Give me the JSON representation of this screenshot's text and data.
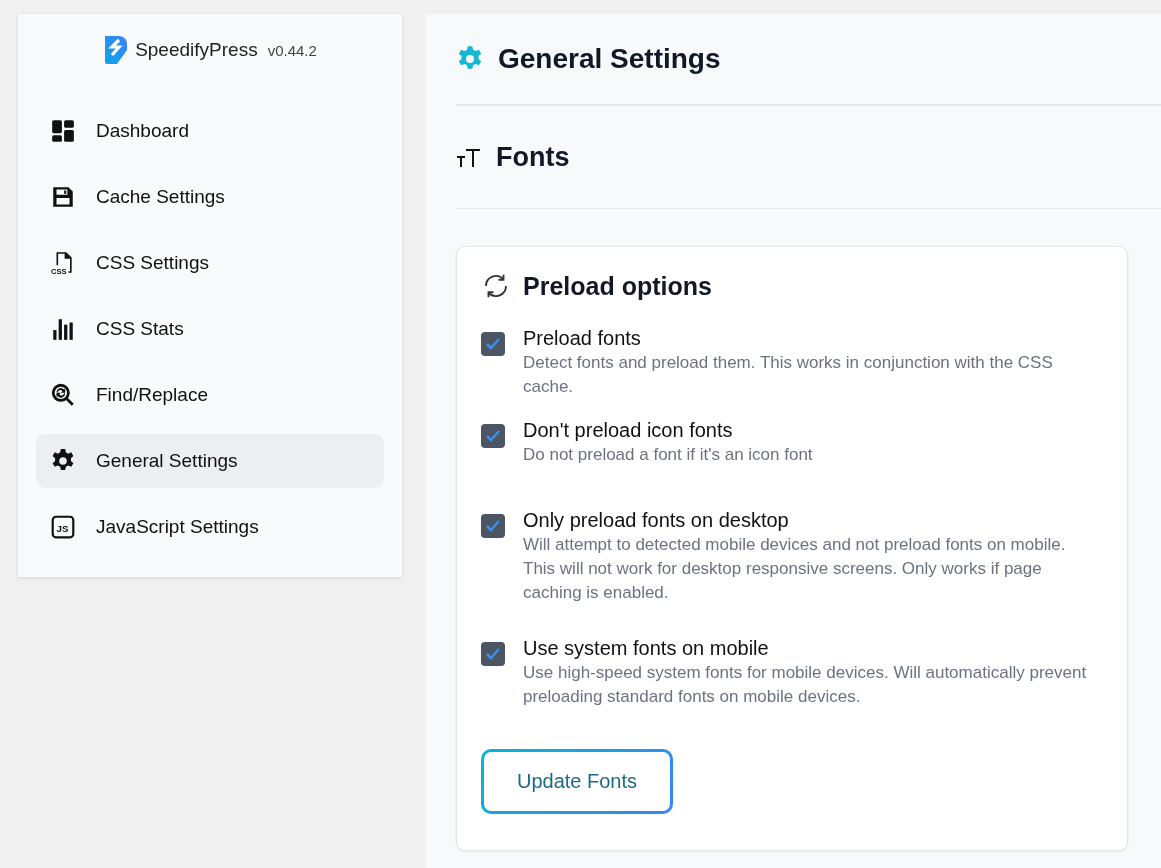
{
  "sidebar": {
    "brand": "SpeedifyPress",
    "version": "v0.44.2",
    "items": [
      {
        "label": "Dashboard",
        "selected": false
      },
      {
        "label": "Cache Settings",
        "selected": false
      },
      {
        "label": "CSS Settings",
        "selected": false,
        "icon_text": "CSS"
      },
      {
        "label": "CSS Stats",
        "selected": false
      },
      {
        "label": "Find/Replace",
        "selected": false
      },
      {
        "label": "General Settings",
        "selected": true
      },
      {
        "label": "JavaScript Settings",
        "selected": false,
        "icon_text": "JS"
      }
    ]
  },
  "page": {
    "title": "General Settings",
    "section": "Fonts",
    "card": {
      "title": "Preload options",
      "options": [
        {
          "label": "Preload fonts",
          "description": "Detect fonts and preload them. This works in conjunction with the CSS cache.",
          "checked": true
        },
        {
          "label": "Don't preload icon fonts",
          "description": "Do not preload a font if it's an icon font",
          "checked": true
        },
        {
          "label": "Only preload fonts on desktop",
          "description": "Will attempt to detected mobile devices and not preload fonts on mobile. This will not work for desktop responsive screens. Only works if page caching is enabled.",
          "checked": true
        },
        {
          "label": "Use system fonts on mobile",
          "description": "Use high-speed system fonts for mobile devices. Will automatically prevent preloading standard fonts on mobile devices.",
          "checked": true
        }
      ],
      "button": "Update Fonts"
    }
  }
}
